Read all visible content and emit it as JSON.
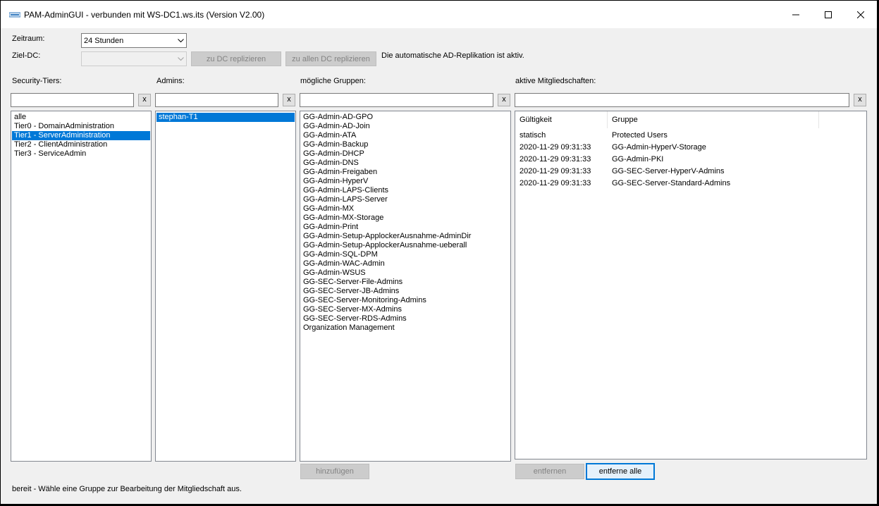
{
  "titlebar": {
    "title": "PAM-AdminGUI - verbunden mit WS-DC1.ws.its (Version V2.00)"
  },
  "top": {
    "zeitraum_label": "Zeitraum:",
    "zeitraum_value": "24 Stunden",
    "zieldc_label": "Ziel-DC:",
    "zieldc_value": "",
    "btn_zu_dc": "zu DC replizieren",
    "btn_zu_allen": "zu allen DC replizieren",
    "replication_status": "Die automatische AD-Replikation ist aktiv."
  },
  "columns": {
    "tiers_label": "Security-Tiers:",
    "admins_label": "Admins:",
    "groups_label": "mögliche Gruppen:",
    "memberships_label": "aktive Mitgliedschaften:",
    "clear_label": "x"
  },
  "tiers": [
    {
      "label": "alle",
      "selected": false
    },
    {
      "label": "Tier0 - DomainAdministration",
      "selected": false
    },
    {
      "label": "Tier1 - ServerAdministration",
      "selected": true
    },
    {
      "label": "Tier2 - ClientAdministration",
      "selected": false
    },
    {
      "label": "Tier3 - ServiceAdmin",
      "selected": false
    }
  ],
  "admins": [
    {
      "label": "stephan-T1",
      "selected": true
    }
  ],
  "groups": [
    "GG-Admin-AD-GPO",
    "GG-Admin-AD-Join",
    "GG-Admin-ATA",
    "GG-Admin-Backup",
    "GG-Admin-DHCP",
    "GG-Admin-DNS",
    "GG-Admin-Freigaben",
    "GG-Admin-HyperV",
    "GG-Admin-LAPS-Clients",
    "GG-Admin-LAPS-Server",
    "GG-Admin-MX",
    "GG-Admin-MX-Storage",
    "GG-Admin-Print",
    "GG-Admin-Setup-ApplockerAusnahme-AdminDir",
    "GG-Admin-Setup-ApplockerAusnahme-ueberall",
    "GG-Admin-SQL-DPM",
    "GG-Admin-WAC-Admin",
    "GG-Admin-WSUS",
    "GG-SEC-Server-File-Admins",
    "GG-SEC-Server-JB-Admins",
    "GG-SEC-Server-Monitoring-Admins",
    "GG-SEC-Server-MX-Admins",
    "GG-SEC-Server-RDS-Admins",
    "Organization Management"
  ],
  "memberships": {
    "headers": [
      "Gültigkeit",
      "Gruppe"
    ],
    "rows": [
      [
        "statisch",
        "Protected Users"
      ],
      [
        "2020-11-29 09:31:33",
        "GG-Admin-HyperV-Storage"
      ],
      [
        "2020-11-29 09:31:33",
        "GG-Admin-PKI"
      ],
      [
        "2020-11-29 09:31:33",
        "GG-SEC-Server-HyperV-Admins"
      ],
      [
        "2020-11-29 09:31:33",
        "GG-SEC-Server-Standard-Admins"
      ]
    ]
  },
  "actions": {
    "add": "hinzufügen",
    "remove": "entfernen",
    "remove_all": "entferne alle"
  },
  "status": "bereit - Wähle eine Gruppe zur Bearbeitung der Mitgliedschaft aus.",
  "colors": {
    "selection": "#0078d7",
    "window_bg": "#f0f0f0"
  }
}
